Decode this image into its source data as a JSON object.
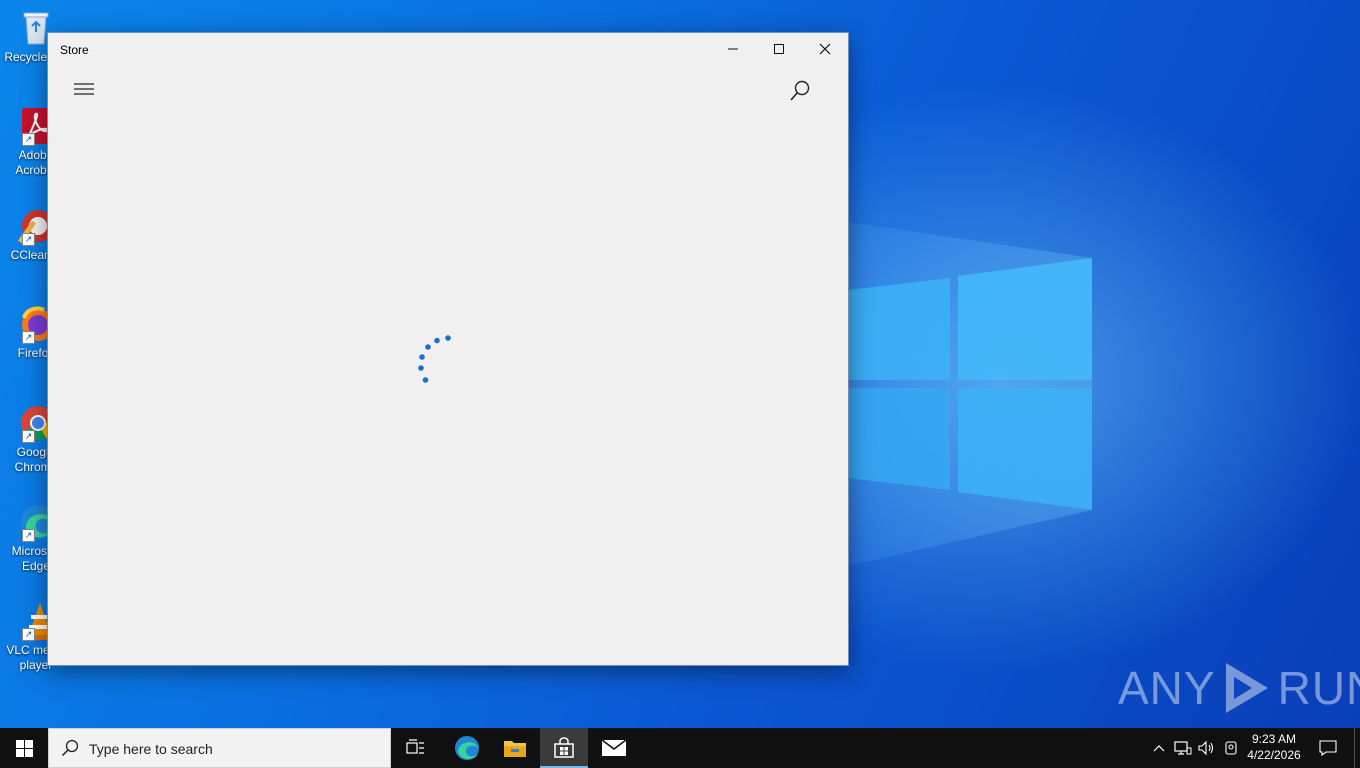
{
  "desktop": {
    "icons": [
      {
        "label": "Recycle Bin",
        "icon": "recycle-bin-icon"
      },
      {
        "label": "Adobe\nAcrobat",
        "icon": "adobe-acrobat-icon"
      },
      {
        "label": "CCleaner",
        "icon": "ccleaner-icon"
      },
      {
        "label": "Firefox",
        "icon": "firefox-icon"
      },
      {
        "label": "Google\nChrome",
        "icon": "chrome-icon"
      },
      {
        "label": "Microsoft\nEdge",
        "icon": "edge-icon"
      },
      {
        "label": "VLC media\nplayer",
        "icon": "vlc-icon"
      }
    ],
    "watermark": {
      "left": "ANY",
      "right": "RUN"
    }
  },
  "window": {
    "title": "Store",
    "controls": [
      "minimize",
      "maximize",
      "close"
    ],
    "loading": true,
    "accent": "#1a6fcf"
  },
  "taskbar": {
    "search_placeholder": "Type here to search",
    "apps": [
      "task-view",
      "edge",
      "file-explorer",
      "store",
      "mail"
    ],
    "active_app": "store",
    "clock": {
      "time": "9:23 AM",
      "date": "4/22/2026"
    }
  }
}
